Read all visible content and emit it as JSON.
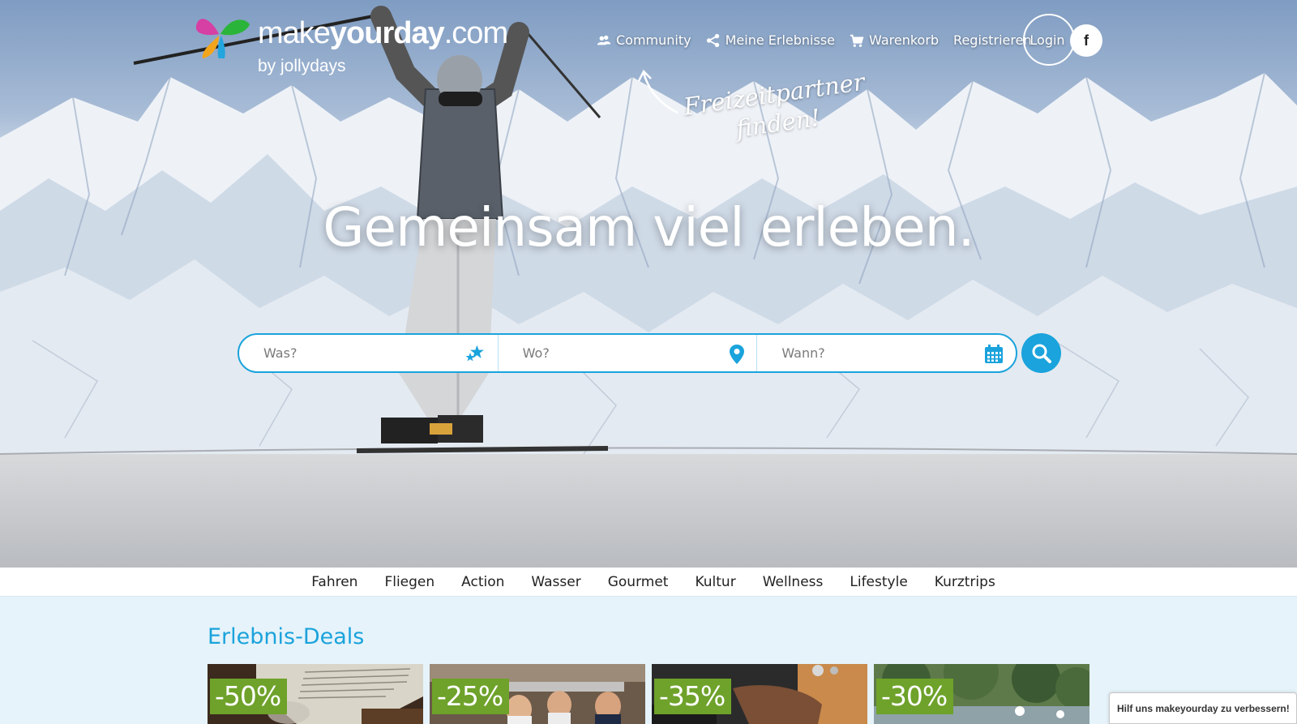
{
  "brand": {
    "logo_light": "make",
    "logo_bold": "yourday",
    "logo_tld": ".com",
    "by_text": "by jollydays"
  },
  "nav": {
    "items": [
      {
        "label": "Community",
        "icon": "community-icon"
      },
      {
        "label": "Meine Erlebnisse",
        "icon": "share-icon"
      },
      {
        "label": "Warenkorb",
        "icon": "cart-icon"
      },
      {
        "label": "Registrieren"
      }
    ],
    "login_label": "Login",
    "facebook_label": "f"
  },
  "hero": {
    "annotation_line1": "Freizeitpartner",
    "annotation_line2": "finden!",
    "headline": "Gemeinsam viel erleben."
  },
  "search": {
    "what_placeholder": "Was?",
    "where_placeholder": "Wo?",
    "when_placeholder": "Wann?",
    "what_icon": "stars-icon",
    "where_icon": "map-pin-icon",
    "when_icon": "calendar-icon",
    "button_icon": "search-icon"
  },
  "categories": [
    "Fahren",
    "Fliegen",
    "Action",
    "Wasser",
    "Gourmet",
    "Kultur",
    "Wellness",
    "Lifestyle",
    "Kurztrips"
  ],
  "deals_section": {
    "title": "Erlebnis-Deals",
    "deals": [
      {
        "discount": "-50%"
      },
      {
        "discount": "-25%"
      },
      {
        "discount": "-35%"
      },
      {
        "discount": "-30%"
      }
    ]
  },
  "feedback": {
    "label": "Hilf uns makeyourday zu verbessern!"
  },
  "colors": {
    "accent": "#1aa3dc",
    "deal_badge": "#6ea22a",
    "section_bg": "#e6f3fa"
  }
}
